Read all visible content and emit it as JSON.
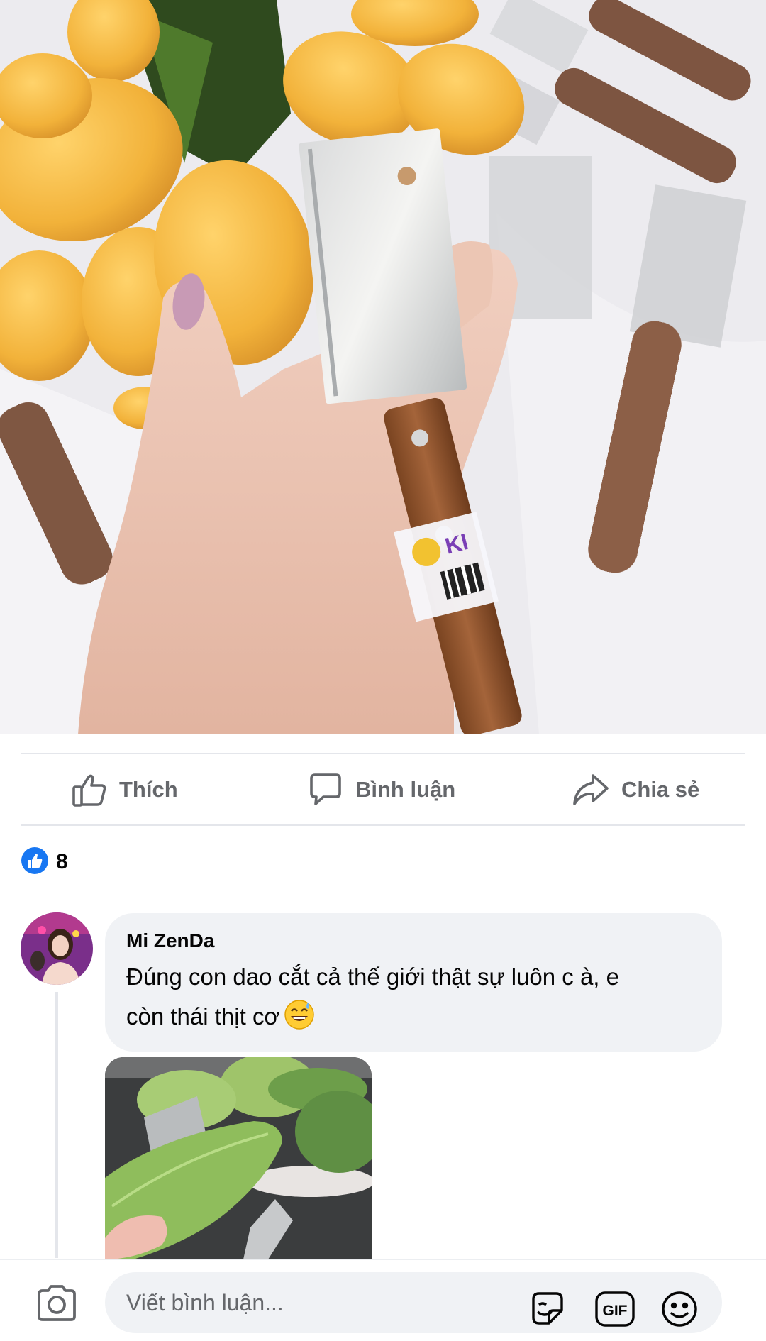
{
  "actions": {
    "like_label": "Thích",
    "comment_label": "Bình luận",
    "share_label": "Chia sẻ"
  },
  "reactions": {
    "type": "like",
    "count": "8",
    "color": "#1877f2"
  },
  "comment": {
    "author": "Mi ZenDa",
    "text_line1": "Đúng con dao cắt cả thế giới thật sự luôn c à, e",
    "text_line2": "còn thái thịt cơ",
    "emoji": "grinning-sweat-emoji"
  },
  "composer": {
    "placeholder": "Viết bình luận...",
    "icons": [
      "camera-icon",
      "sticker-icon",
      "gif-icon",
      "emoji-icon"
    ],
    "gif_label": "GIF"
  },
  "colors": {
    "accent": "#1877f2",
    "muted_text": "#65676b",
    "bubble_bg": "#f0f2f5",
    "divider": "#e4e6eb"
  }
}
